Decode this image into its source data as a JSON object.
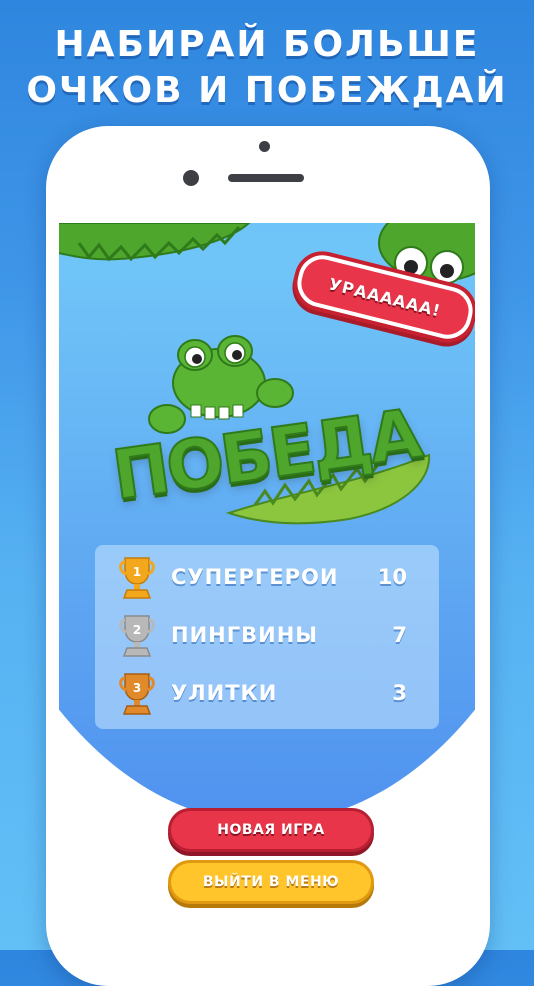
{
  "headline": {
    "line1": "НАБИРАЙ БОЛЬШЕ",
    "line2": "ОЧКОВ И ПОБЕЖДАЙ"
  },
  "screen": {
    "cheer_badge": "УРАААААА!",
    "victory_title": "ПОБЕДА",
    "scoreboard": [
      {
        "place": "1",
        "trophy": "gold-trophy-icon",
        "team": "СУПЕРГЕРОИ",
        "score": "10"
      },
      {
        "place": "2",
        "trophy": "silver-trophy-icon",
        "team": "ПИНГВИНЫ",
        "score": "7"
      },
      {
        "place": "3",
        "trophy": "bronze-trophy-icon",
        "team": "УЛИТКИ",
        "score": "3"
      }
    ],
    "buttons": {
      "new_game": "НОВАЯ ИГРА",
      "exit_menu": "ВЫЙТИ В МЕНЮ"
    }
  },
  "colors": {
    "accent_red": "#e8354a",
    "accent_yellow": "#ffc52a",
    "crocodile_green": "#4ea62c",
    "gold": "#f2a71c",
    "silver": "#b8b8b8",
    "bronze": "#e08a2c"
  }
}
